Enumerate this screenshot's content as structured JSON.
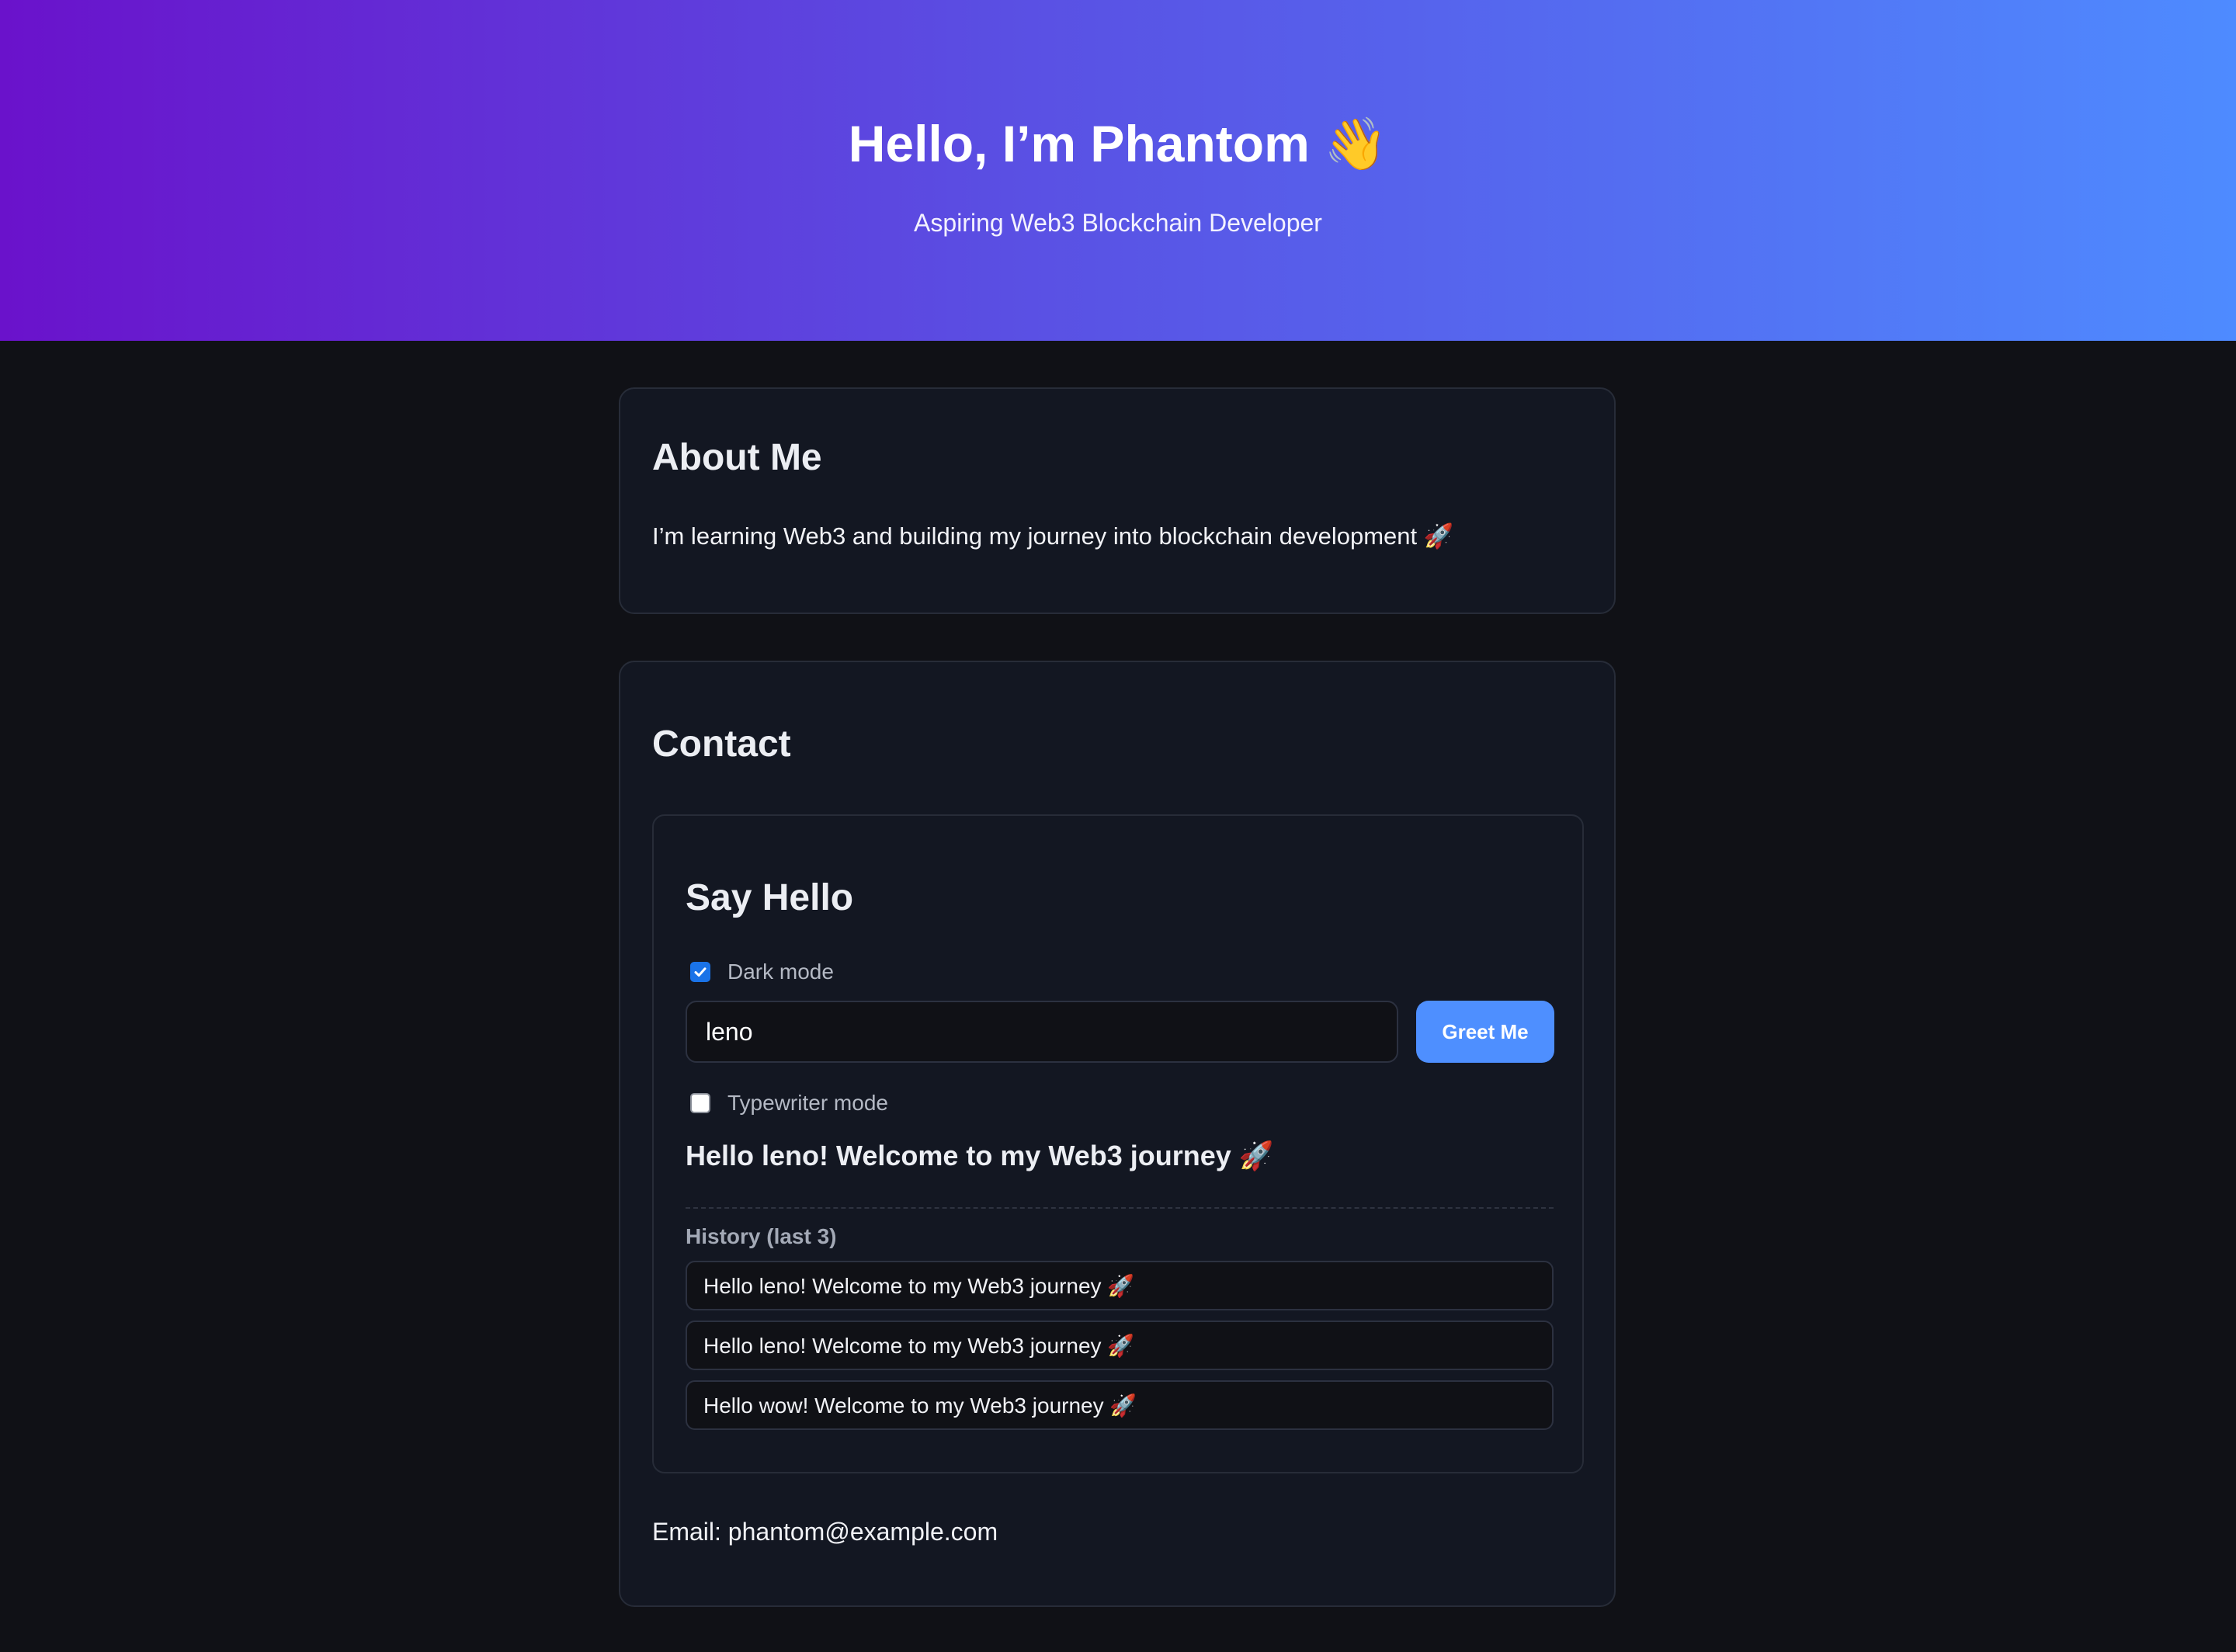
{
  "header": {
    "title": "Hello, I’m Phantom 👋",
    "subtitle": "Aspiring Web3 Blockchain Developer",
    "gradient_start": "#6a12cb",
    "gradient_end": "#4e8bff"
  },
  "about": {
    "heading": "About Me",
    "text": "I’m learning Web3 and building my journey into blockchain development 🚀"
  },
  "contact": {
    "heading": "Contact",
    "say_hello": {
      "heading": "Say Hello",
      "dark_mode_label": "Dark mode",
      "dark_mode_checked": true,
      "name_value": "leno",
      "greet_button_label": "Greet Me",
      "typewriter_label": "Typewriter mode",
      "typewriter_checked": false,
      "greeting": "Hello leno! Welcome to my Web3 journey 🚀",
      "history_label": "History (last 3)",
      "history": [
        "Hello leno! Welcome to my Web3 journey 🚀",
        "Hello leno! Welcome to my Web3 journey 🚀",
        "Hello wow! Welcome to my Web3 journey 🚀"
      ]
    },
    "email_line": "Email: phantom@example.com"
  },
  "colors": {
    "page_background": "#101116",
    "card_background": "#131722",
    "accent_button": "#4e8fff",
    "checkbox_checked": "#1a73e8"
  }
}
